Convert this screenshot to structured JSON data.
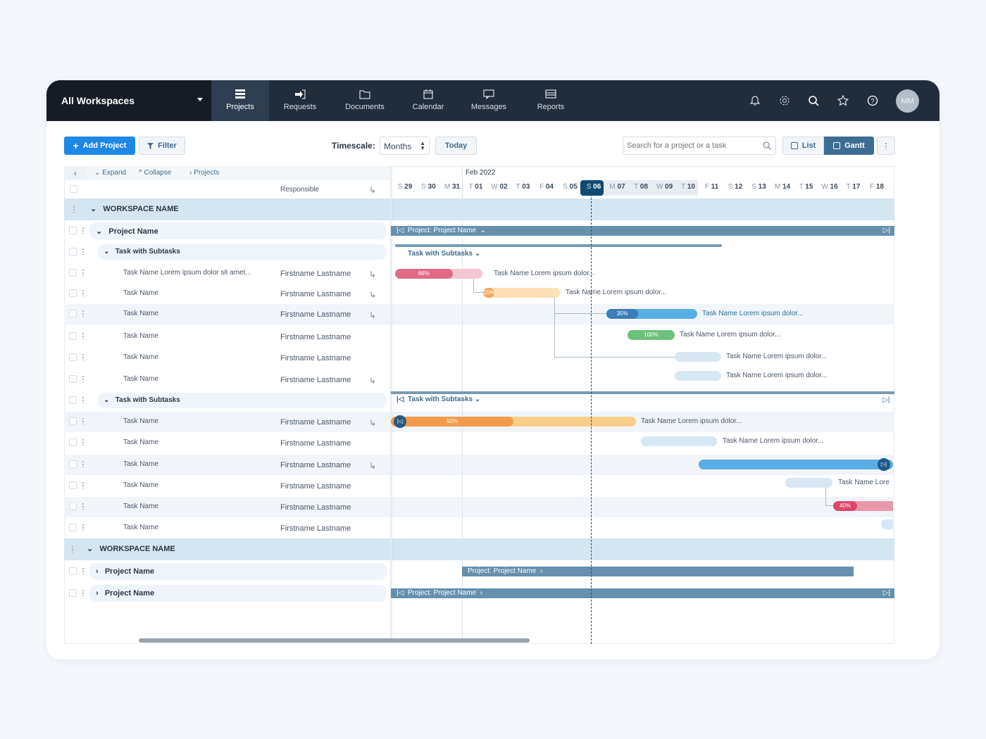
{
  "nav": {
    "workspace": "All Workspaces",
    "tabs": [
      {
        "label": "Projects",
        "icon": "projects-icon",
        "active": true
      },
      {
        "label": "Requests",
        "icon": "sign-in-icon"
      },
      {
        "label": "Documents",
        "icon": "folder-icon"
      },
      {
        "label": "Calendar",
        "icon": "calendar-icon"
      },
      {
        "label": "Messages",
        "icon": "message-icon"
      },
      {
        "label": "Reports",
        "icon": "reports-icon"
      }
    ],
    "icons": [
      "bell-icon",
      "gear-icon",
      "search-icon",
      "star-icon",
      "help-icon"
    ],
    "avatar": "MM"
  },
  "toolbar": {
    "add_project": "Add Project",
    "filter": "Filter",
    "timescale_label": "Timescale:",
    "timescale_value": "Months",
    "today": "Today",
    "search_placeholder": "Search for a project or a task",
    "list": "List",
    "gantt": "Gantt",
    "active_view": "Gantt"
  },
  "table": {
    "expand": "Expand",
    "collapse": "Collapse",
    "breadcrumb": "Projects",
    "responsible_header": "Responsible"
  },
  "timeline": {
    "month": "Feb 2022",
    "today": "S 06",
    "days": [
      [
        "S",
        "29"
      ],
      [
        "S",
        "30"
      ],
      [
        "M",
        "31"
      ],
      [
        "T",
        "01"
      ],
      [
        "W",
        "02"
      ],
      [
        "T",
        "03"
      ],
      [
        "F",
        "04"
      ],
      [
        "S",
        "05"
      ],
      [
        "S",
        "06"
      ],
      [
        "M",
        "07"
      ],
      [
        "T",
        "08"
      ],
      [
        "W",
        "09"
      ],
      [
        "T",
        "10"
      ],
      [
        "F",
        "11"
      ],
      [
        "S",
        "12"
      ],
      [
        "S",
        "13"
      ],
      [
        "M",
        "14"
      ],
      [
        "T",
        "15"
      ],
      [
        "W",
        "16"
      ],
      [
        "T",
        "17"
      ],
      [
        "F",
        "18"
      ]
    ]
  },
  "rows": [
    {
      "type": "workspace",
      "name": "WORKSPACE NAME"
    },
    {
      "type": "project",
      "name": "Project Name",
      "expanded": true
    },
    {
      "type": "group",
      "name": "Task with Subtasks"
    },
    {
      "type": "task",
      "name": "Task Name Lorem ipsum dolor sit amet...",
      "resp": "Firstname Lastname",
      "sub": true
    },
    {
      "type": "task",
      "name": "Task Name",
      "resp": "Firstname Lastname",
      "sub": true
    },
    {
      "type": "task",
      "name": "Task Name",
      "resp": "Firstname Lastname",
      "sub": true,
      "hl": true
    },
    {
      "type": "task",
      "name": "Task Name",
      "resp": "Firstname Lastname"
    },
    {
      "type": "task",
      "name": "Task Name",
      "resp": "Firstname Lastname"
    },
    {
      "type": "task",
      "name": "Task Name",
      "resp": "Firstname Lastname",
      "sub": true
    },
    {
      "type": "group",
      "name": "Task with Subtasks"
    },
    {
      "type": "task",
      "name": "Task Name",
      "resp": "Firstname Lastname",
      "sub": true,
      "hl": true
    },
    {
      "type": "task",
      "name": "Task Name",
      "resp": "Firstname Lastname"
    },
    {
      "type": "task",
      "name": "Task Name",
      "resp": "Firstname Lastname",
      "sub": true,
      "hl": true
    },
    {
      "type": "task",
      "name": "Task Name",
      "resp": "Firstname Lastname"
    },
    {
      "type": "task",
      "name": "Task Name",
      "resp": "Firstname Lastname",
      "hl": true
    },
    {
      "type": "task",
      "name": "Task Name",
      "resp": "Firstname Lastname"
    },
    {
      "type": "workspace",
      "name": "WORKSPACE NAME"
    },
    {
      "type": "project",
      "name": "Project Name",
      "expanded": false
    },
    {
      "type": "project",
      "name": "Project Name",
      "expanded": false
    }
  ],
  "gantt": {
    "project1": "Project: Project Name",
    "group1": "Task with Subtasks",
    "group2": "Task with Subtasks",
    "project2": "Project: Project Name",
    "project3": "Project: Project Name",
    "bars": [
      {
        "progress": 66,
        "label": "66%",
        "text": "Task Name Lorem ipsum dolor...",
        "color": "#e06a86",
        "track": "#f3c6d2"
      },
      {
        "progress": 15,
        "label": "15%",
        "text": "Task Name Lorem ipsum dolor...",
        "color": "#f6a55a",
        "track": "#fde0b5"
      },
      {
        "progress": 35,
        "label": "35%",
        "text": "Task Name Lorem ipsum dolor...",
        "color": "#3b7fb8",
        "track": "#5aaee6"
      },
      {
        "progress": 100,
        "label": "100%",
        "text": "Task Name Lorem ipsum dolor...",
        "color": "#6cc17a",
        "track": "#6cc17a"
      },
      {
        "progress": 0,
        "label": "",
        "text": "Task Name Lorem ipsum dolor...",
        "color": "#d6e8f3",
        "track": "#d6e8f3"
      },
      {
        "progress": 0,
        "label": "",
        "text": "Task Name Lorem ipsum dolor...",
        "color": "#d6e8f3",
        "track": "#d6e8f3"
      },
      {
        "progress": 50,
        "label": "50%",
        "text": "Task Name Lorem ipsum dolor...",
        "color": "#f59a4a",
        "track": "#f9cd8a"
      },
      {
        "progress": 0,
        "label": "",
        "text": "Task Name Lorem ipsum dolor...",
        "color": "#d6e8f3",
        "track": "#d6e8f3"
      },
      {
        "progress": 100,
        "label": "",
        "text": "",
        "color": "#5aaee6",
        "track": "#5aaee6"
      },
      {
        "progress": 0,
        "label": "",
        "text": "Task Name Lore",
        "color": "#d6e8f3",
        "track": "#d6e8f3"
      },
      {
        "progress": 40,
        "label": "40%",
        "text": "",
        "color": "#d9486a",
        "track": "#e898ab"
      },
      {
        "progress": 0,
        "label": "",
        "text": "",
        "color": "#d6e8f3",
        "track": "#d6e8f3"
      }
    ]
  },
  "colors": {
    "nav": "#222d3c",
    "primary": "#1e88e5",
    "gantt_active": "#3e6d94",
    "today": "#0f4a73",
    "project_bar": "#6690ad",
    "workspace_band": "#d3e6f2"
  }
}
